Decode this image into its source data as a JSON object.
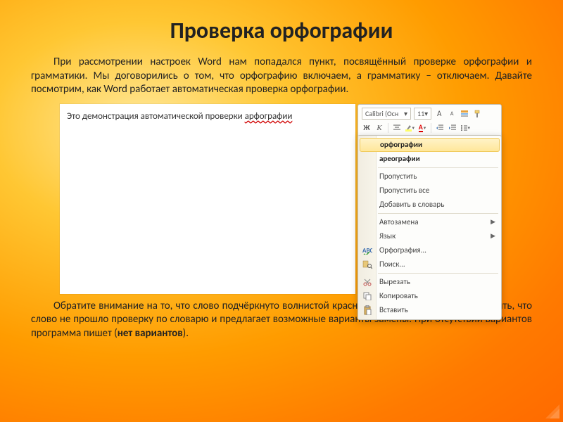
{
  "title": "Проверка орфографии",
  "para1": "При рассмотрении настроек Word нам попадался пункт, посвящённый проверке орфографии и грамматики. Мы договорились о том, что орфографию включаем, а грамматику – отключаем. Давайте посмотрим, как Word работает автоматическая проверка орфографии.",
  "para2_a": "Обратите внимание на то, что слово подчёркнуто волнистой красной чертой, – т.о. Wordдаёт понять, что слово не прошло проверку по словарю и предлагает возможные варианты замены. При отсутствии вариантов программа пишет (",
  "para2_bold": "нет вариантов",
  "para2_b": ").",
  "doc": {
    "text": "Это демонстрация автоматической проверки ",
    "misspelled": "арфографии"
  },
  "minitoolbar": {
    "font": "Calibri (Осн",
    "size": "11",
    "grow": "A",
    "shrink": "A"
  },
  "menu": {
    "suggest1": "орфографии",
    "suggest2": "ареографии",
    "ignore": "Пропустить",
    "ignore_all": "Пропустить все",
    "add_dict": "Добавить в словарь",
    "autocorrect": "Автозамена",
    "language": "Язык",
    "spelling": "Орфография...",
    "lookup": "Поиск...",
    "cut": "Вырезать",
    "copy": "Копировать",
    "paste": "Вставить"
  }
}
